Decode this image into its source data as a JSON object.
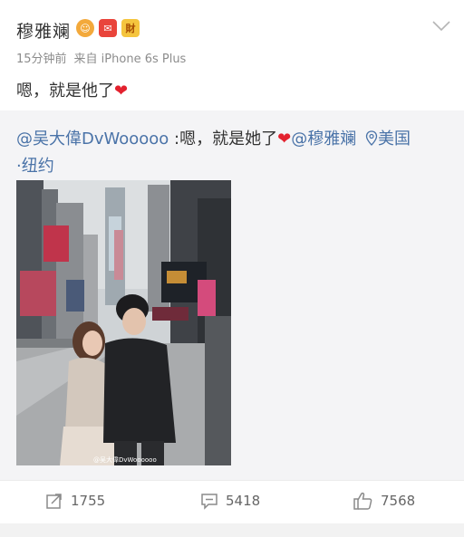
{
  "post": {
    "username": "穆雅斓",
    "badges": [
      "会员",
      "红包",
      "财"
    ],
    "time": "15分钟前",
    "source": "来自 iPhone 6s Plus",
    "text": "嗯，就是他了",
    "heart": "❤"
  },
  "repost": {
    "mention_author": "@吴大偉DvWooooo",
    "text": " :嗯，就是她了",
    "heart": "❤",
    "mention_user": "@穆雅斓",
    "location_icon": "location-pin-icon",
    "location": "美国",
    "location_line2": "·纽约",
    "photo_watermark": "@吴大偉DvWoooooo"
  },
  "actions": {
    "repost_count": "1755",
    "comment_count": "5418",
    "like_count": "7568"
  },
  "colors": {
    "link": "#4a73a8",
    "heart": "#e3212e",
    "repost_bg": "#f4f4f6",
    "meta": "#8c8c8c"
  }
}
